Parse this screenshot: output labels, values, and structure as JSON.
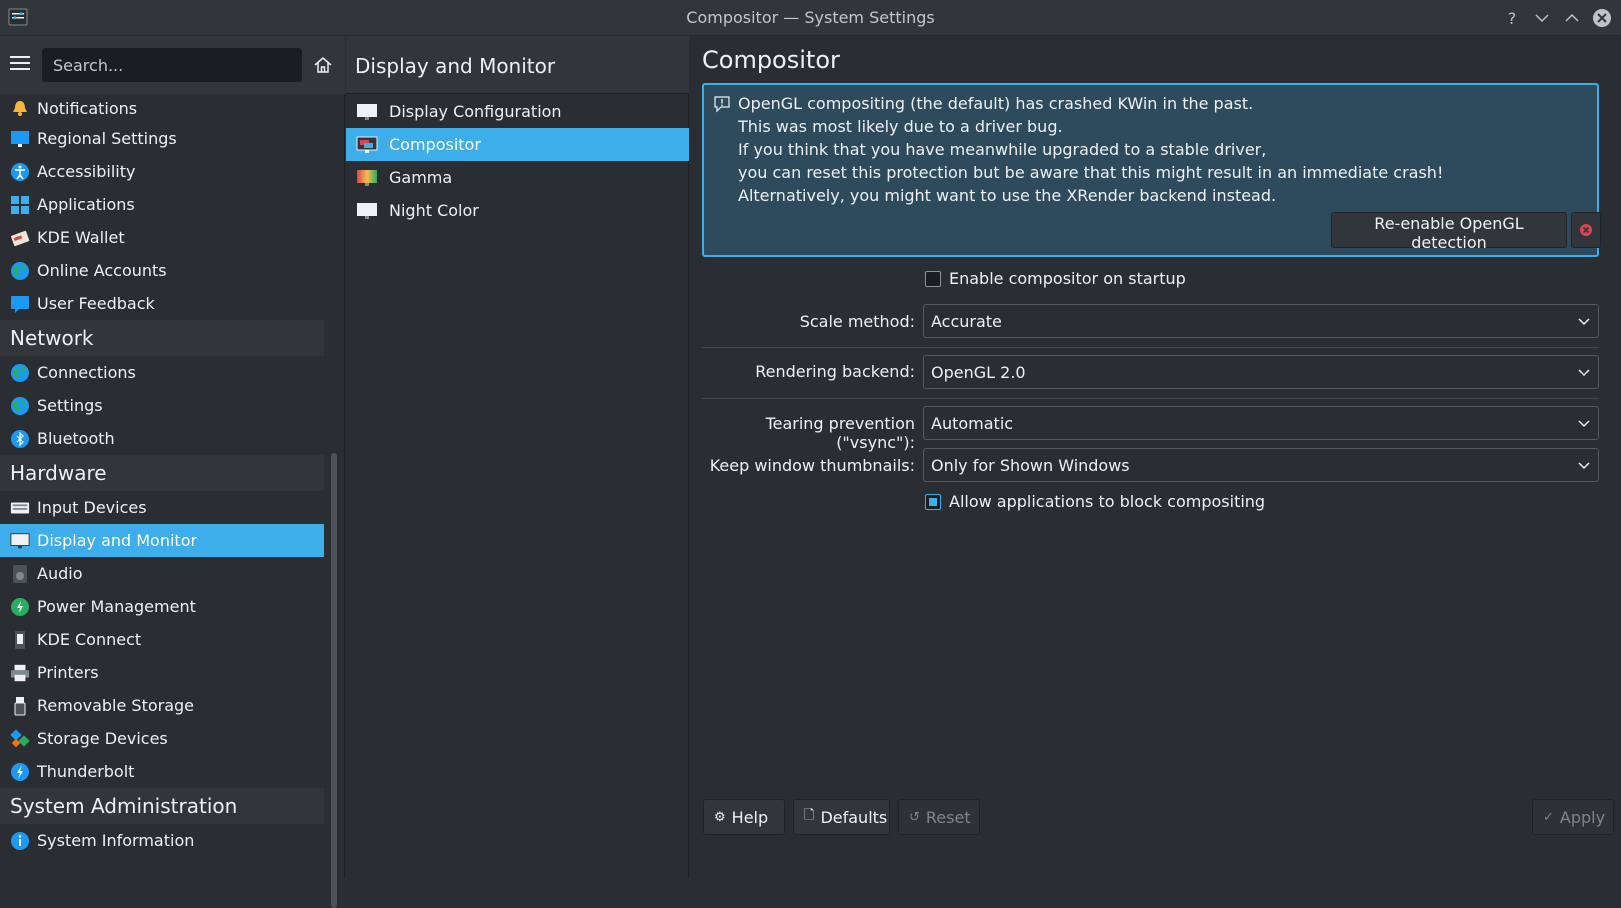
{
  "window": {
    "title": "Compositor — System Settings"
  },
  "sidebar": {
    "search_placeholder": "Search...",
    "items": [
      {
        "label": "Notifications",
        "icon": "bell-icon"
      },
      {
        "label": "Regional Settings",
        "icon": "regional-icon"
      },
      {
        "label": "Accessibility",
        "icon": "accessibility-icon"
      },
      {
        "label": "Applications",
        "icon": "applications-icon"
      },
      {
        "label": "KDE Wallet",
        "icon": "wallet-icon"
      },
      {
        "label": "Online Accounts",
        "icon": "globe-icon"
      },
      {
        "label": "User Feedback",
        "icon": "feedback-icon"
      }
    ],
    "categories": {
      "network": {
        "title": "Network",
        "items": [
          {
            "label": "Connections",
            "icon": "globe-icon"
          },
          {
            "label": "Settings",
            "icon": "globe-icon"
          },
          {
            "label": "Bluetooth",
            "icon": "bluetooth-icon"
          }
        ]
      },
      "hardware": {
        "title": "Hardware",
        "items": [
          {
            "label": "Input Devices",
            "icon": "keyboard-icon"
          },
          {
            "label": "Display and Monitor",
            "icon": "monitor-icon"
          },
          {
            "label": "Audio",
            "icon": "speaker-icon"
          },
          {
            "label": "Power Management",
            "icon": "power-icon"
          },
          {
            "label": "KDE Connect",
            "icon": "phone-icon"
          },
          {
            "label": "Printers",
            "icon": "printer-icon"
          },
          {
            "label": "Removable Storage",
            "icon": "usb-icon"
          },
          {
            "label": "Storage Devices",
            "icon": "storage-icon"
          },
          {
            "label": "Thunderbolt",
            "icon": "thunderbolt-icon"
          }
        ]
      },
      "sysadmin": {
        "title": "System Administration",
        "items": [
          {
            "label": "System Information",
            "icon": "info-icon"
          }
        ]
      }
    }
  },
  "midpane": {
    "title": "Display and Monitor",
    "items": [
      {
        "label": "Display Configuration"
      },
      {
        "label": "Compositor"
      },
      {
        "label": "Gamma"
      },
      {
        "label": "Night Color"
      }
    ]
  },
  "content": {
    "title": "Compositor",
    "warning": {
      "line1": "OpenGL compositing (the default) has crashed KWin in the past.",
      "line2": "This was most likely due to a driver bug.",
      "line3": "If you think that you have meanwhile upgraded to a stable driver,",
      "line4": "you can reset this protection but be aware that this might result in an immediate crash!",
      "line5": "Alternatively, you might want to use the XRender backend instead.",
      "button": "Re-enable OpenGL detection"
    },
    "enable_on_startup": "Enable compositor on startup",
    "scale_method_label": "Scale method:",
    "scale_method_value": "Accurate",
    "rendering_backend_label": "Rendering backend:",
    "rendering_backend_value": "OpenGL 2.0",
    "tearing_label": "Tearing prevention (\"vsync\"):",
    "tearing_value": "Automatic",
    "thumbnails_label": "Keep window thumbnails:",
    "thumbnails_value": "Only for Shown Windows",
    "allow_block": "Allow applications to block compositing"
  },
  "footer": {
    "help": "Help",
    "defaults": "Defaults",
    "reset": "Reset",
    "apply": "Apply"
  },
  "colors": {
    "accent": "#3daee9",
    "background": "#2a2e32",
    "header": "#31363b"
  }
}
